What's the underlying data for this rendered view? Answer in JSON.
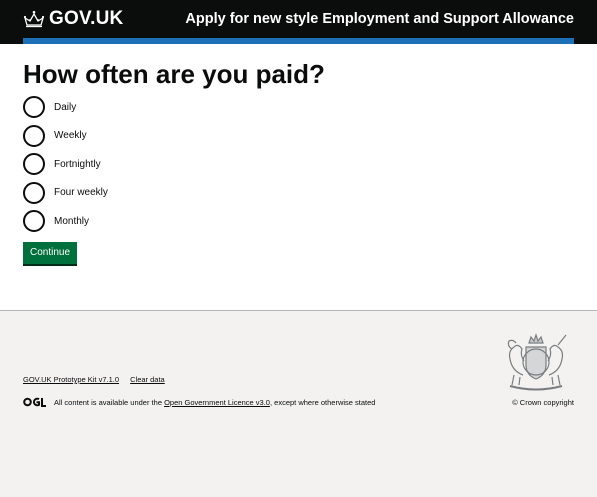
{
  "header": {
    "logo_text": "GOV.UK",
    "service_name": "Apply for new style Employment and Support Allowance"
  },
  "main": {
    "heading": "How often are you paid?",
    "options": [
      {
        "label": "Daily",
        "checked": false
      },
      {
        "label": "Weekly",
        "checked": false
      },
      {
        "label": "Fortnightly",
        "checked": false
      },
      {
        "label": "Four weekly",
        "checked": false
      },
      {
        "label": "Monthly",
        "checked": false
      }
    ],
    "continue_label": "Continue"
  },
  "footer": {
    "links": [
      "GOV.UK Prototype Kit v7.1.0",
      "Clear data"
    ],
    "licence_prefix": "All content is available under the ",
    "licence_link": "Open Government Licence v3.0",
    "licence_suffix": ", except where otherwise stated",
    "copyright": "© Crown copyright"
  },
  "colors": {
    "header_bg": "#0b0c0c",
    "header_accent": "#1d70b8",
    "button_green": "#00703c",
    "footer_bg": "#f3f2f1"
  },
  "icons": [
    "crown-icon",
    "ogl-icon",
    "royal-crest-icon"
  ]
}
